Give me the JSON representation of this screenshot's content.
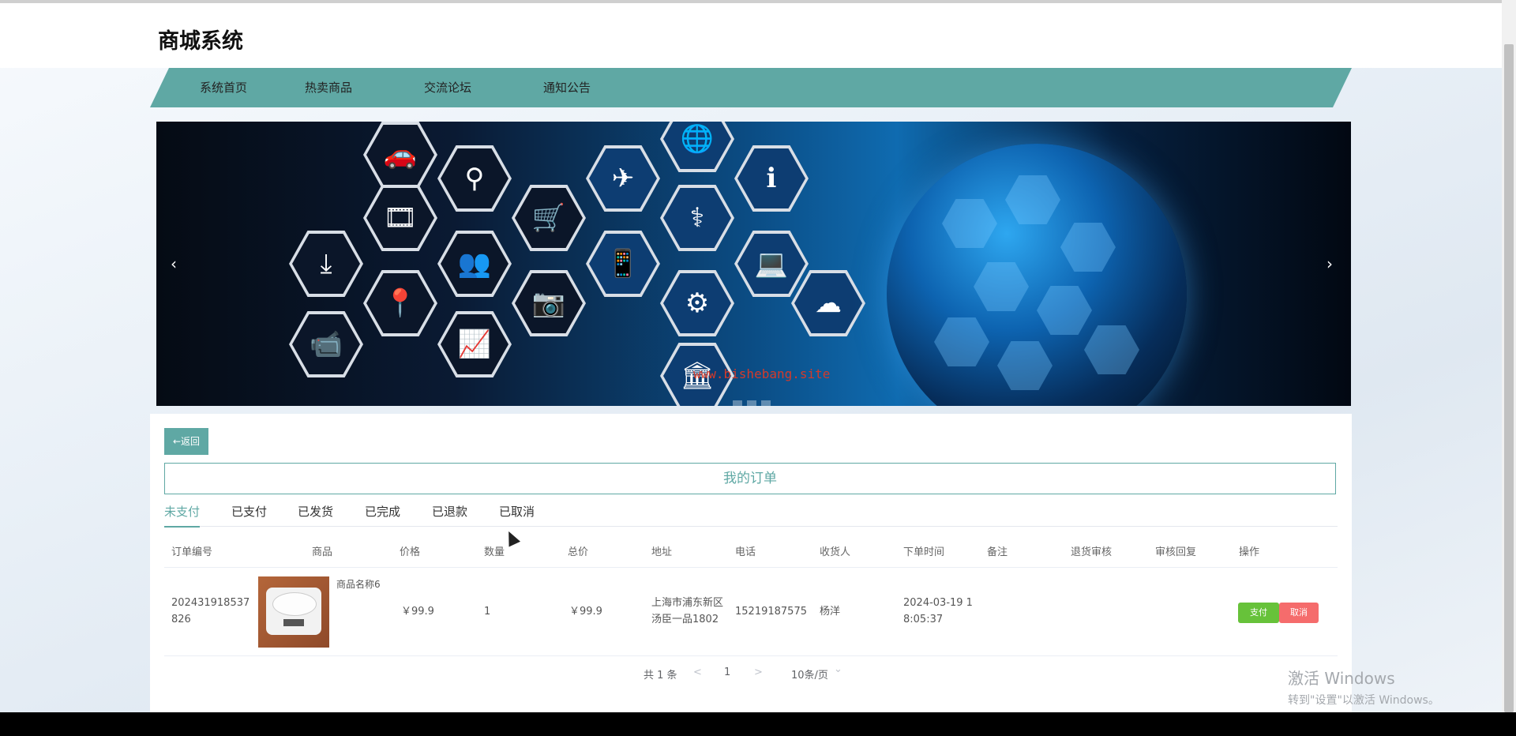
{
  "app": {
    "title": "商城系统"
  },
  "nav": {
    "items": [
      "系统首页",
      "热卖商品",
      "交流论坛",
      "通知公告"
    ]
  },
  "banner": {
    "watermark": "www.bishebang.site",
    "prev_icon": "‹",
    "next_icon": "›"
  },
  "orders": {
    "back_label": "←返回",
    "title": "我的订单",
    "tabs": [
      "未支付",
      "已支付",
      "已发货",
      "已完成",
      "已退款",
      "已取消"
    ],
    "active_tab": "未支付",
    "columns": [
      "订单编号",
      "商品",
      "价格",
      "数量",
      "总价",
      "地址",
      "电话",
      "收货人",
      "下单时间",
      "备注",
      "退货审核",
      "审核回复",
      "操作"
    ],
    "rows": [
      {
        "order_no_1": "202431918537",
        "order_no_2": "826",
        "product_name": "商品名称6",
        "price": "￥99.9",
        "quantity": "1",
        "total": "￥99.9",
        "address_1": "上海市浦东新区",
        "address_2": "汤臣一品1802",
        "phone": "15219187575",
        "receiver": "杨洋",
        "time_1": "2024-03-19 1",
        "time_2": "8:05:37",
        "pay_label": "支付",
        "cancel_label": "取消"
      }
    ]
  },
  "pagination": {
    "total": "共 1 条",
    "prev": "<",
    "page": "1",
    "next": ">",
    "page_size": "10条/页",
    "size_caret": "⌄"
  },
  "windows": {
    "activate_title": "激活 Windows",
    "activate_sub": "转到\"设置\"以激活 Windows。"
  },
  "colors": {
    "accent": "#5fa8a4",
    "pay": "#67c23a",
    "cancel": "#f56c6c"
  }
}
